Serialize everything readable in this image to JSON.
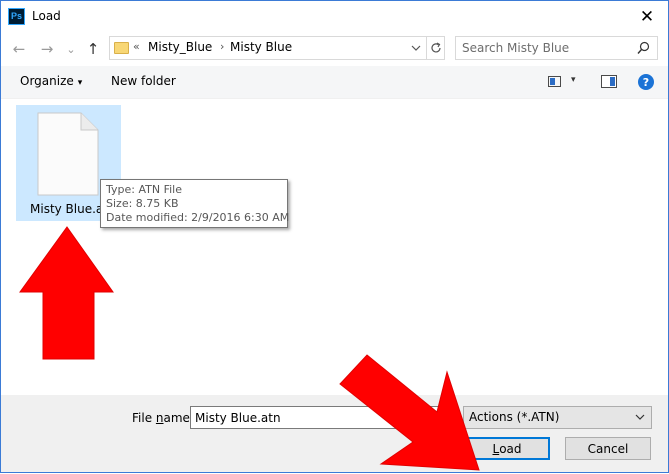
{
  "window": {
    "app_icon_text": "Ps",
    "title": "Load",
    "close_glyph": "✕"
  },
  "nav": {
    "back": "←",
    "forward": "→",
    "recent": "⌄",
    "up": "↑",
    "breadcrumb_prefix": "«",
    "breadcrumbs": [
      "Misty_Blue",
      "Misty Blue"
    ],
    "breadcrumb_sep": "›",
    "search_placeholder": "Search Misty Blue"
  },
  "toolbar": {
    "organize_label": "Organize",
    "organize_caret": "▾",
    "new_folder_label": "New folder",
    "view_caret": "▾",
    "help_glyph": "?"
  },
  "files": [
    {
      "label": "Misty Blue.atn"
    }
  ],
  "tooltip": {
    "type": "Type: ATN File",
    "size": "Size: 8.75 KB",
    "modified": "Date modified: 2/9/2016 6:30 AM"
  },
  "footer": {
    "file_name_label_pre": "File ",
    "file_name_label_key": "n",
    "file_name_label_post": "ame:",
    "file_name_value": "Misty Blue.atn",
    "file_type_selected": "Actions (*.ATN)",
    "load_key": "L",
    "load_rest": "oad",
    "cancel_label": "Cancel"
  },
  "colors": {
    "selection": "#cce8ff",
    "annotation_arrow": "#ff0000",
    "default_button_border": "#0078d7"
  }
}
